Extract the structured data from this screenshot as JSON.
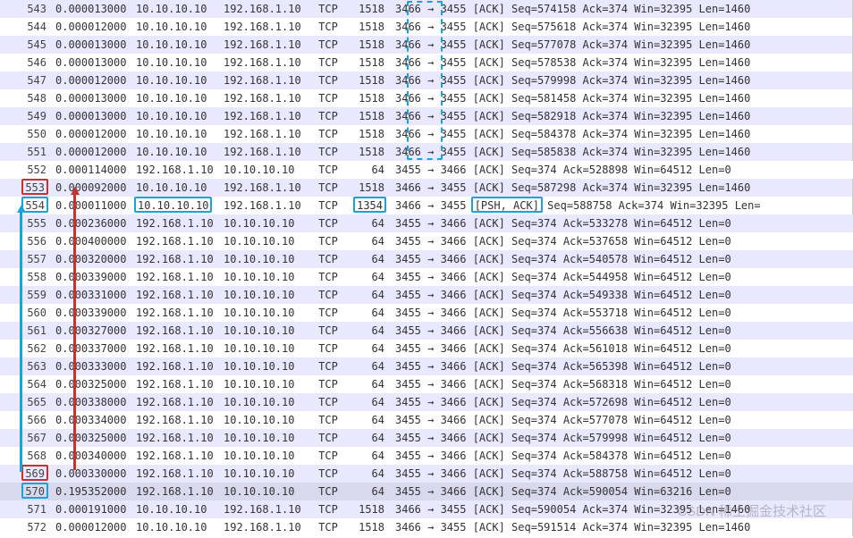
{
  "watermark": "CSDN 稀土掘金技术社区",
  "packets": [
    {
      "no": "543",
      "time": "0.000013000",
      "src": "10.10.10.10",
      "dst": "192.168.1.10",
      "proto": "TCP",
      "len": "1518",
      "s": "3466",
      "d": "3455",
      "flags": "[ACK]",
      "xtra": "Seq=574158 Ack=374 Win=32395 Len=1460",
      "r": "a",
      "cut": true
    },
    {
      "no": "544",
      "time": "0.000012000",
      "src": "10.10.10.10",
      "dst": "192.168.1.10",
      "proto": "TCP",
      "len": "1518",
      "s": "3466",
      "d": "3455",
      "flags": "[ACK]",
      "xtra": "Seq=575618 Ack=374 Win=32395 Len=1460",
      "r": "b",
      "cut": true
    },
    {
      "no": "545",
      "time": "0.000013000",
      "src": "10.10.10.10",
      "dst": "192.168.1.10",
      "proto": "TCP",
      "len": "1518",
      "s": "3466",
      "d": "3455",
      "flags": "[ACK]",
      "xtra": "Seq=577078 Ack=374 Win=32395 Len=1460",
      "r": "a",
      "cut": true
    },
    {
      "no": "546",
      "time": "0.000013000",
      "src": "10.10.10.10",
      "dst": "192.168.1.10",
      "proto": "TCP",
      "len": "1518",
      "s": "3466",
      "d": "3455",
      "flags": "[ACK]",
      "xtra": "Seq=578538 Ack=374 Win=32395 Len=1460",
      "r": "b",
      "cut": true
    },
    {
      "no": "547",
      "time": "0.000012000",
      "src": "10.10.10.10",
      "dst": "192.168.1.10",
      "proto": "TCP",
      "len": "1518",
      "s": "3466",
      "d": "3455",
      "flags": "[ACK]",
      "xtra": "Seq=579998 Ack=374 Win=32395 Len=1460",
      "r": "a",
      "cut": true
    },
    {
      "no": "548",
      "time": "0.000013000",
      "src": "10.10.10.10",
      "dst": "192.168.1.10",
      "proto": "TCP",
      "len": "1518",
      "s": "3466",
      "d": "3455",
      "flags": "[ACK]",
      "xtra": "Seq=581458 Ack=374 Win=32395 Len=1460",
      "r": "b",
      "cut": true
    },
    {
      "no": "549",
      "time": "0.000013000",
      "src": "10.10.10.10",
      "dst": "192.168.1.10",
      "proto": "TCP",
      "len": "1518",
      "s": "3466",
      "d": "3455",
      "flags": "[ACK]",
      "xtra": "Seq=582918 Ack=374 Win=32395 Len=1460",
      "r": "a",
      "cut": true
    },
    {
      "no": "550",
      "time": "0.000012000",
      "src": "10.10.10.10",
      "dst": "192.168.1.10",
      "proto": "TCP",
      "len": "1518",
      "s": "3466",
      "d": "3455",
      "flags": "[ACK]",
      "xtra": "Seq=584378 Ack=374 Win=32395 Len=1460",
      "r": "b",
      "cut": true
    },
    {
      "no": "551",
      "time": "0.000012000",
      "src": "10.10.10.10",
      "dst": "192.168.1.10",
      "proto": "TCP",
      "len": "1518",
      "s": "3466",
      "d": "3455",
      "flags": "[ACK]",
      "xtra": "Seq=585838 Ack=374 Win=32395 Len=1460",
      "r": "a",
      "cut": true
    },
    {
      "no": "552",
      "time": "0.000114000",
      "src": "192.168.1.10",
      "dst": "10.10.10.10",
      "proto": "TCP",
      "len": "64",
      "s": "3455",
      "d": "3466",
      "flags": "[ACK]",
      "xtra": "Seq=374 Ack=528898 Win=64512 Len=0",
      "r": "b"
    },
    {
      "no": "553",
      "noBox": "red",
      "time": "0.000092000",
      "src": "10.10.10.10",
      "dst": "192.168.1.10",
      "proto": "TCP",
      "len": "1518",
      "s": "3466",
      "d": "3455",
      "flags": "[ACK]",
      "xtra": "Seq=587298 Ack=374 Win=32395 Len=1460",
      "r": "a",
      "cut": true
    },
    {
      "no": "554",
      "noBox": "cyan",
      "time": "0.000011000",
      "src": "10.10.10.10",
      "srcBox": "cyan",
      "dst": "192.168.1.10",
      "proto": "TCP",
      "len": "1354",
      "lenBox": "cyan",
      "s": "3466",
      "d": "3455",
      "flags": "[PSH, ACK]",
      "flagsBox": "cyan",
      "xtra": "Seq=588758 Ack=374 Win=32395 Len=",
      "r": "b",
      "cut": true
    },
    {
      "no": "555",
      "time": "0.000236000",
      "src": "192.168.1.10",
      "dst": "10.10.10.10",
      "proto": "TCP",
      "len": "64",
      "s": "3455",
      "d": "3466",
      "flags": "[ACK]",
      "xtra": "Seq=374 Ack=533278 Win=64512 Len=0",
      "r": "a"
    },
    {
      "no": "556",
      "time": "0.000400000",
      "src": "192.168.1.10",
      "dst": "10.10.10.10",
      "proto": "TCP",
      "len": "64",
      "s": "3455",
      "d": "3466",
      "flags": "[ACK]",
      "xtra": "Seq=374 Ack=537658 Win=64512 Len=0",
      "r": "b"
    },
    {
      "no": "557",
      "time": "0.000320000",
      "src": "192.168.1.10",
      "dst": "10.10.10.10",
      "proto": "TCP",
      "len": "64",
      "s": "3455",
      "d": "3466",
      "flags": "[ACK]",
      "xtra": "Seq=374 Ack=540578 Win=64512 Len=0",
      "r": "a"
    },
    {
      "no": "558",
      "time": "0.000339000",
      "src": "192.168.1.10",
      "dst": "10.10.10.10",
      "proto": "TCP",
      "len": "64",
      "s": "3455",
      "d": "3466",
      "flags": "[ACK]",
      "xtra": "Seq=374 Ack=544958 Win=64512 Len=0",
      "r": "b"
    },
    {
      "no": "559",
      "time": "0.000331000",
      "src": "192.168.1.10",
      "dst": "10.10.10.10",
      "proto": "TCP",
      "len": "64",
      "s": "3455",
      "d": "3466",
      "flags": "[ACK]",
      "xtra": "Seq=374 Ack=549338 Win=64512 Len=0",
      "r": "a"
    },
    {
      "no": "560",
      "time": "0.000339000",
      "src": "192.168.1.10",
      "dst": "10.10.10.10",
      "proto": "TCP",
      "len": "64",
      "s": "3455",
      "d": "3466",
      "flags": "[ACK]",
      "xtra": "Seq=374 Ack=553718 Win=64512 Len=0",
      "r": "b"
    },
    {
      "no": "561",
      "time": "0.000327000",
      "src": "192.168.1.10",
      "dst": "10.10.10.10",
      "proto": "TCP",
      "len": "64",
      "s": "3455",
      "d": "3466",
      "flags": "[ACK]",
      "xtra": "Seq=374 Ack=556638 Win=64512 Len=0",
      "r": "a"
    },
    {
      "no": "562",
      "time": "0.000337000",
      "src": "192.168.1.10",
      "dst": "10.10.10.10",
      "proto": "TCP",
      "len": "64",
      "s": "3455",
      "d": "3466",
      "flags": "[ACK]",
      "xtra": "Seq=374 Ack=561018 Win=64512 Len=0",
      "r": "b"
    },
    {
      "no": "563",
      "time": "0.000333000",
      "src": "192.168.1.10",
      "dst": "10.10.10.10",
      "proto": "TCP",
      "len": "64",
      "s": "3455",
      "d": "3466",
      "flags": "[ACK]",
      "xtra": "Seq=374 Ack=565398 Win=64512 Len=0",
      "r": "a"
    },
    {
      "no": "564",
      "time": "0.000325000",
      "src": "192.168.1.10",
      "dst": "10.10.10.10",
      "proto": "TCP",
      "len": "64",
      "s": "3455",
      "d": "3466",
      "flags": "[ACK]",
      "xtra": "Seq=374 Ack=568318 Win=64512 Len=0",
      "r": "b"
    },
    {
      "no": "565",
      "time": "0.000338000",
      "src": "192.168.1.10",
      "dst": "10.10.10.10",
      "proto": "TCP",
      "len": "64",
      "s": "3455",
      "d": "3466",
      "flags": "[ACK]",
      "xtra": "Seq=374 Ack=572698 Win=64512 Len=0",
      "r": "a"
    },
    {
      "no": "566",
      "time": "0.000334000",
      "src": "192.168.1.10",
      "dst": "10.10.10.10",
      "proto": "TCP",
      "len": "64",
      "s": "3455",
      "d": "3466",
      "flags": "[ACK]",
      "xtra": "Seq=374 Ack=577078 Win=64512 Len=0",
      "r": "b"
    },
    {
      "no": "567",
      "time": "0.000325000",
      "src": "192.168.1.10",
      "dst": "10.10.10.10",
      "proto": "TCP",
      "len": "64",
      "s": "3455",
      "d": "3466",
      "flags": "[ACK]",
      "xtra": "Seq=374 Ack=579998 Win=64512 Len=0",
      "r": "a"
    },
    {
      "no": "568",
      "time": "0.000340000",
      "src": "192.168.1.10",
      "dst": "10.10.10.10",
      "proto": "TCP",
      "len": "64",
      "s": "3455",
      "d": "3466",
      "flags": "[ACK]",
      "xtra": "Seq=374 Ack=584378 Win=64512 Len=0",
      "r": "b"
    },
    {
      "no": "569",
      "noBox": "red",
      "time": "0.000330000",
      "src": "192.168.1.10",
      "dst": "10.10.10.10",
      "proto": "TCP",
      "len": "64",
      "s": "3455",
      "d": "3466",
      "flags": "[ACK]",
      "xtra": "Seq=374 Ack=588758 Win=64512 Len=0",
      "r": "a"
    },
    {
      "no": "570",
      "noBox": "cyan",
      "time": "0.195352000",
      "src": "192.168.1.10",
      "dst": "10.10.10.10",
      "proto": "TCP",
      "len": "64",
      "s": "3455",
      "d": "3466",
      "flags": "[ACK]",
      "xtra": "Seq=374 Ack=590054 Win=63216 Len=0",
      "r": "sel"
    },
    {
      "no": "571",
      "time": "0.000191000",
      "src": "10.10.10.10",
      "dst": "192.168.1.10",
      "proto": "TCP",
      "len": "1518",
      "s": "3466",
      "d": "3455",
      "flags": "[ACK]",
      "xtra": "Seq=590054 Ack=374 Win=32395 Len=1460",
      "r": "a",
      "cut": true
    },
    {
      "no": "572",
      "time": "0.000012000",
      "src": "10.10.10.10",
      "dst": "192.168.1.10",
      "proto": "TCP",
      "len": "1518",
      "s": "3466",
      "d": "3455",
      "flags": "[ACK]",
      "xtra": "Seq=591514 Ack=374 Win=32395 Len=1460",
      "r": "b",
      "cut": true
    }
  ]
}
